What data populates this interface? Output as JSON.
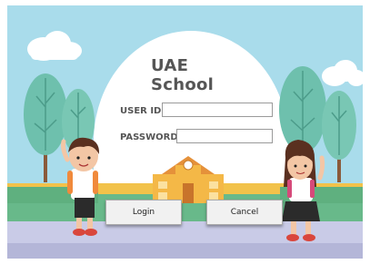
{
  "login": {
    "title": "UAE School",
    "user_id_label": "USER ID :",
    "password_label": "PASSWORD :",
    "user_id_value": "",
    "password_value": "",
    "login_button": "Login",
    "cancel_button": "Cancel"
  },
  "colors": {
    "sky": "#a9dceb",
    "ground_yellow": "#f2c24a",
    "grass": "#68b98a",
    "path": "#c9cbe7",
    "tree_green": "#6ec0ad",
    "building": "#f4b847"
  }
}
